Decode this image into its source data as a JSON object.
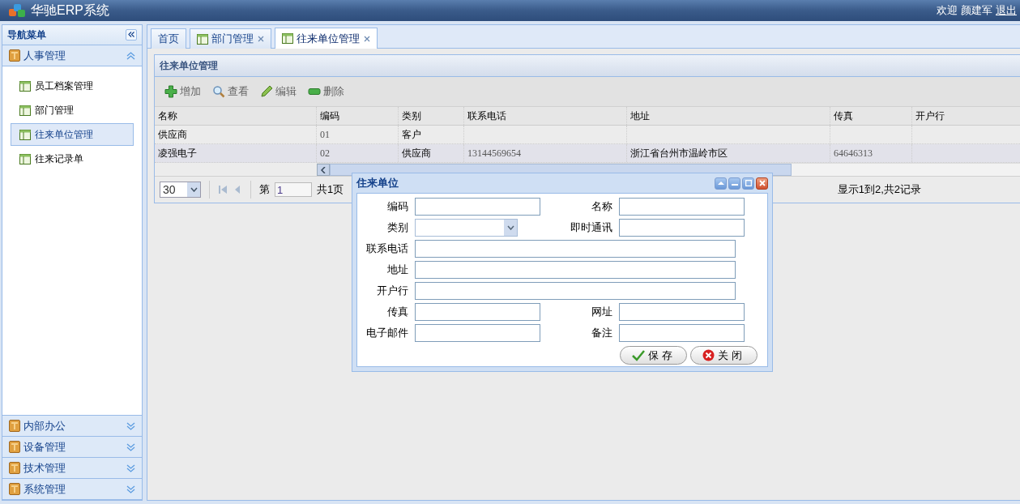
{
  "app": {
    "title": "华驰ERP系统"
  },
  "user_bar": {
    "greeting": "欢迎",
    "user": "颜建军",
    "logout": "退出"
  },
  "sidebar": {
    "title": "导航菜单",
    "groups": [
      {
        "label": "人事管理",
        "expanded": true,
        "items": [
          {
            "label": "员工档案管理",
            "selected": false
          },
          {
            "label": "部门管理",
            "selected": false
          },
          {
            "label": "往来单位管理",
            "selected": true
          },
          {
            "label": "往来记录单",
            "selected": false
          }
        ]
      },
      {
        "label": "内部办公",
        "expanded": false
      },
      {
        "label": "设备管理",
        "expanded": false
      },
      {
        "label": "技术管理",
        "expanded": false
      },
      {
        "label": "系统管理",
        "expanded": false
      }
    ]
  },
  "tabs": [
    {
      "label": "首页",
      "closable": false,
      "selected": false
    },
    {
      "label": "部门管理",
      "closable": true,
      "selected": false
    },
    {
      "label": "往来单位管理",
      "closable": true,
      "selected": true
    }
  ],
  "panel": {
    "title": "往来单位管理",
    "toolbar": [
      {
        "label": "增加",
        "kind": "add"
      },
      {
        "label": "查看",
        "kind": "view"
      },
      {
        "label": "编辑",
        "kind": "edit"
      },
      {
        "label": "删除",
        "kind": "delete"
      }
    ],
    "table": {
      "columns": [
        "名称",
        "编码",
        "类别",
        "联系电话",
        "地址",
        "传真",
        "开户行"
      ],
      "rows": [
        [
          "供应商",
          "01",
          "客户",
          "",
          "",
          "",
          ""
        ],
        [
          "凌强电子",
          "02",
          "供应商",
          "13144569654",
          "浙江省台州市温岭市区",
          "64646313",
          ""
        ]
      ]
    },
    "pager": {
      "page_size": "30",
      "page_prefix": "第",
      "page": "1",
      "page_total": "共1页",
      "summary": "显示1到2,共2记录"
    }
  },
  "dialog": {
    "title": "住来单位",
    "fields": [
      {
        "label": "编码",
        "kind": "text"
      },
      {
        "label": "名称",
        "kind": "text"
      },
      {
        "label": "类别",
        "kind": "select"
      },
      {
        "label": "即时通讯",
        "kind": "text"
      },
      {
        "label": "联系电话",
        "kind": "wide"
      },
      {
        "label": "地址",
        "kind": "wide"
      },
      {
        "label": "开户行",
        "kind": "wide"
      },
      {
        "label": "传真",
        "kind": "text"
      },
      {
        "label": "网址",
        "kind": "text"
      },
      {
        "label": "电子邮件",
        "kind": "text"
      },
      {
        "label": "备注",
        "kind": "text"
      }
    ],
    "buttons": [
      {
        "label": "保存",
        "kind": "save"
      },
      {
        "label": "关闭",
        "kind": "close"
      }
    ]
  }
}
